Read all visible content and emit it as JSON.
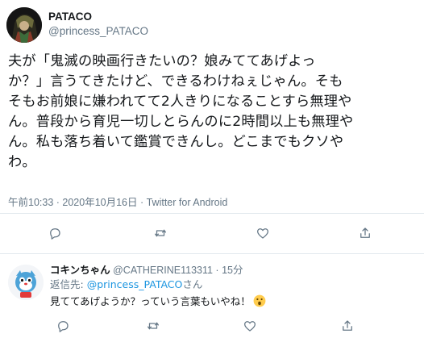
{
  "tweet": {
    "display_name": "PATACO",
    "handle": "@princess_PATACO",
    "text_lines": [
      "夫が「鬼滅の映画行きたいの？娘みててあげよっ",
      "か？」言うてきたけど、できるわけねぇじゃん。そも",
      "そもお前娘に嫌われてて2人きりになることすら無理や",
      "ん。普段から育児一切しとらんのに2時間以上も無理や",
      "ん。私も落ち着いて鑑賞できんし。どこまでもクソや",
      "わ。"
    ],
    "meta": "午前10:33 · 2020年10月16日 · Twitter for Android"
  },
  "reply": {
    "display_name": "コキンちゃん",
    "handle_time": " @CATHERINE113311 · 15分",
    "reply_to_prefix": "返信先: ",
    "reply_to_link": "@princess_PATACO",
    "reply_to_suffix": "さん",
    "text": "見ててあげようか？っていう言葉もいやね！"
  },
  "icons": [
    "reply-icon",
    "retweet-icon",
    "like-icon",
    "share-icon",
    "surprised-face-emoji"
  ],
  "colors": {
    "text": "#14171a",
    "secondary": "#657786",
    "link": "#1b95e0",
    "divider": "#e1e8ed"
  }
}
